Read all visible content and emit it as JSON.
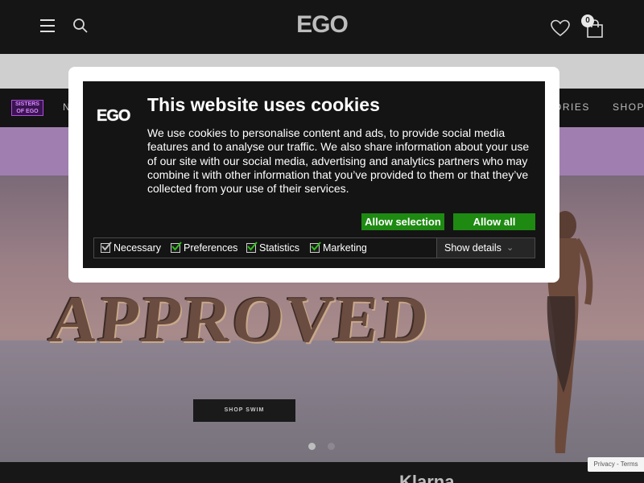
{
  "header": {
    "logo": "EGO",
    "bag_count": "0"
  },
  "nav": {
    "badge": "SISTERS OF EGO",
    "items": [
      {
        "label": "N"
      },
      {
        "label": "ORIES"
      },
      {
        "label": "SHOP"
      }
    ]
  },
  "hero": {
    "title": "APPROVED",
    "button_label": "SHOP SWIM",
    "slides": 2,
    "active_slide": 1
  },
  "footer": {
    "payment": "Klarna",
    "recaptcha": "Privacy - Terms"
  },
  "cookie": {
    "logo": "EGO",
    "title": "This website uses cookies",
    "body": "We use cookies to personalise content and ads, to provide social media features and to analyse our traffic. We also share information about your use of our site with our social media, advertising and analytics partners who may combine it with other information that you’ve provided to them or that they’ve collected from your use of their services.",
    "allow_selection": "Allow selection",
    "allow_all": "Allow all",
    "checks": [
      {
        "label": "Necessary",
        "checked": true
      },
      {
        "label": "Preferences",
        "checked": true
      },
      {
        "label": "Statistics",
        "checked": true
      },
      {
        "label": "Marketing",
        "checked": true
      }
    ],
    "details_label": "Show details"
  },
  "colors": {
    "accent_green": "#1e8a12",
    "promo_purple": "#a07fb0",
    "header_bg": "#151515"
  }
}
